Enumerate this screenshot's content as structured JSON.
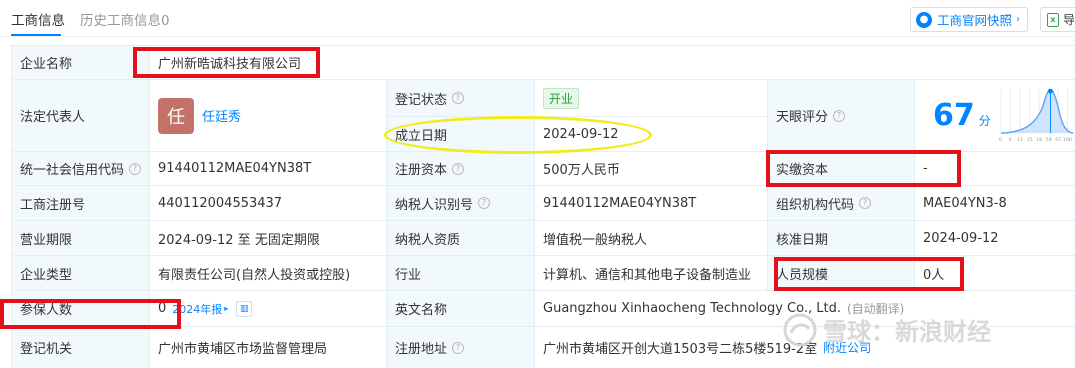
{
  "tabs": {
    "active": "工商信息",
    "inactive": "历史工商信息0"
  },
  "toolbar": {
    "snapshot_label": "工商官网快照",
    "snapshot_arrow": "›",
    "export_label": "导"
  },
  "rows": {
    "company_name": {
      "label": "企业名称",
      "value": "广州新晧诚科技有限公司"
    },
    "legal_rep": {
      "label": "法定代表人",
      "avatar_char": "任",
      "value": "任廷秀"
    },
    "reg_status": {
      "label": "登记状态",
      "value": "开业"
    },
    "established": {
      "label": "成立日期",
      "value": "2024-09-12"
    },
    "tianyan_score": {
      "label": "天眼评分",
      "value": "67",
      "unit": "分"
    },
    "credit_code": {
      "label": "统一社会信用代码",
      "value": "91440112MAE04YN38T"
    },
    "reg_capital": {
      "label": "注册资本",
      "value": "500万人民币"
    },
    "paid_capital": {
      "label": "实缴资本",
      "value": "-"
    },
    "reg_number": {
      "label": "工商注册号",
      "value": "440112004553437"
    },
    "taxpayer_id": {
      "label": "纳税人识别号",
      "value": "91440112MAE04YN38T"
    },
    "org_code": {
      "label": "组织机构代码",
      "value": "MAE04YN3-8"
    },
    "business_term": {
      "label": "营业期限",
      "value": "2024-09-12 至 无固定期限"
    },
    "taxpayer_qual": {
      "label": "纳税人资质",
      "value": "增值税一般纳税人"
    },
    "approval_date": {
      "label": "核准日期",
      "value": "2024-09-12"
    },
    "company_type": {
      "label": "企业类型",
      "value": "有限责任公司(自然人投资或控股)"
    },
    "industry": {
      "label": "行业",
      "value": "计算机、通信和其他电子设备制造业"
    },
    "staff_size": {
      "label": "人员规模",
      "value": "0人"
    },
    "insured": {
      "label": "参保人数",
      "value": "0",
      "report": "2024年报",
      "report_arrow": "▸"
    },
    "english_name": {
      "label": "英文名称",
      "value": "Guangzhou Xinhaocheng Technology Co., Ltd.",
      "auto": "(自动翻译)"
    },
    "reg_authority": {
      "label": "登记机关",
      "value": "广州市黄埔区市场监督管理局"
    },
    "reg_address": {
      "label": "注册地址",
      "value": "广州市黄埔区开创大道1503号二栋5楼519-2室",
      "nearby": "附近公司"
    }
  },
  "chart_ticks": [
    "0",
    "4",
    "11",
    "15",
    "18",
    "58",
    "67",
    "100"
  ],
  "watermark": "雪球：新浪财经",
  "colors": {
    "accent": "#0084ff",
    "label_bg": "#f2f9fc",
    "highlight_red": "#e4101c",
    "highlight_yellow": "#f2ec1d",
    "open_badge": "#2a9d3a"
  }
}
